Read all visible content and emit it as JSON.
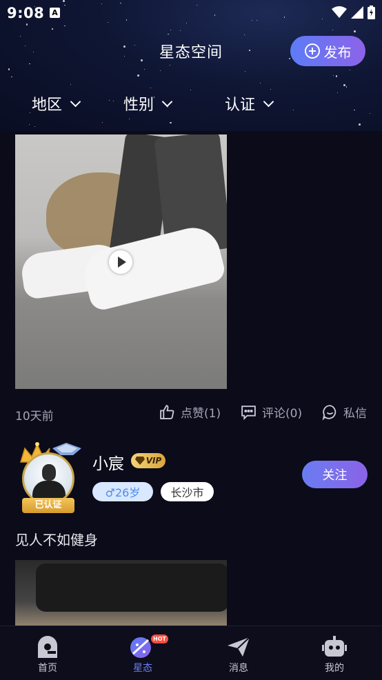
{
  "status_bar": {
    "time": "9:08",
    "notification_icon": "A"
  },
  "header": {
    "title": "星态空间",
    "publish_label": "发布",
    "filters": [
      {
        "label": "地区"
      },
      {
        "label": "性别"
      },
      {
        "label": "认证"
      }
    ]
  },
  "post1": {
    "time_ago": "10天前",
    "like_label": "点赞(1)",
    "comment_label": "评论(0)",
    "message_label": "私信"
  },
  "post2": {
    "username": "小宸",
    "vip_label": "VIP",
    "verified_label": "已认证",
    "gender_age": "♂26岁",
    "city": "长沙市",
    "follow_label": "关注",
    "text": "见人不如健身"
  },
  "tabbar": {
    "tabs": [
      {
        "label": "首页",
        "icon": "home-icon"
      },
      {
        "label": "星态",
        "icon": "planet-icon",
        "badge": "HOT"
      },
      {
        "label": "消息",
        "icon": "paper-plane-icon"
      },
      {
        "label": "我的",
        "icon": "robot-icon"
      }
    ],
    "active_color": "#6b7ef4"
  },
  "colors": {
    "accent_start": "#5d7cf7",
    "accent_end": "#8c63e8",
    "background": "#0b0b1a"
  }
}
